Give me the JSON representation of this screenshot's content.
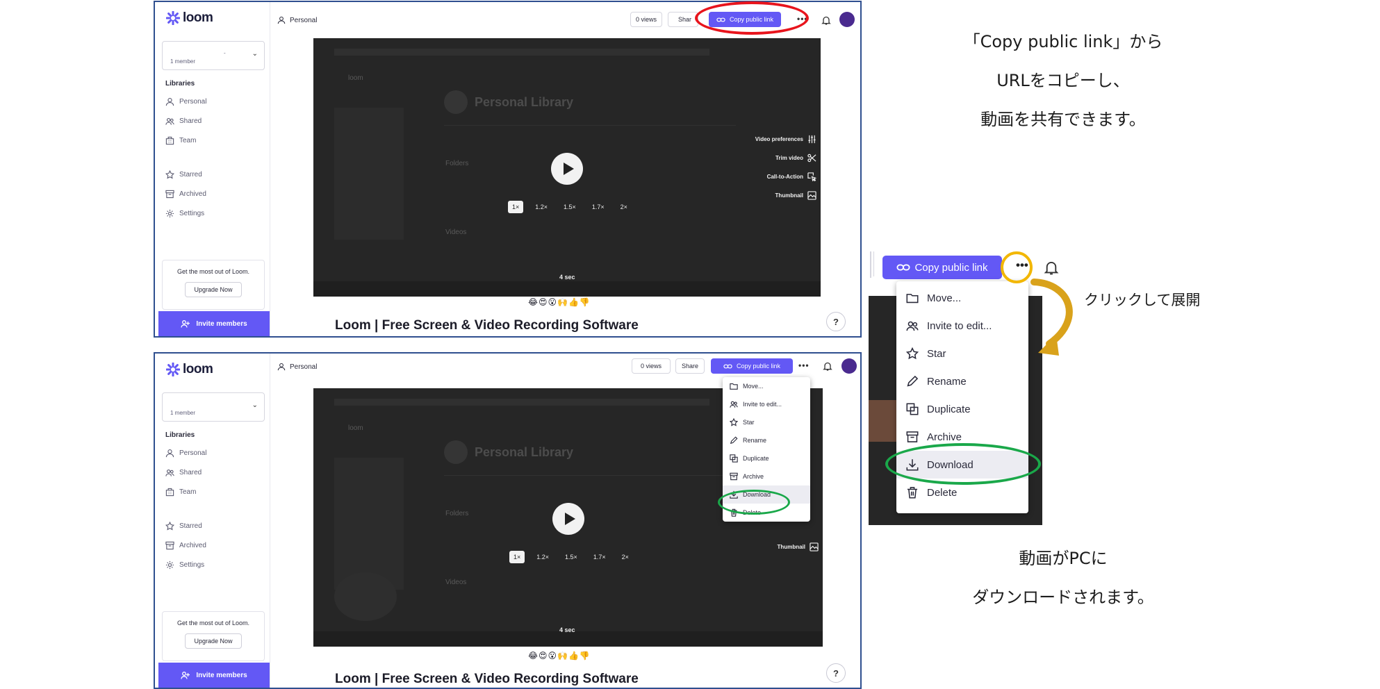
{
  "app": {
    "logo": "loom",
    "workspace_sub": "1 member",
    "workspace_name": "-",
    "libraries_heading": "Libraries",
    "sidebar_items": [
      {
        "label": "Personal",
        "icon": "person-icon"
      },
      {
        "label": "Shared",
        "icon": "people-icon"
      },
      {
        "label": "Team",
        "icon": "building-icon"
      },
      {
        "label": "Starred",
        "icon": "star-icon"
      },
      {
        "label": "Archived",
        "icon": "archive-icon"
      },
      {
        "label": "Settings",
        "icon": "gear-icon"
      }
    ],
    "promo_text": "Get the most out of Loom.",
    "upgrade_label": "Upgrade Now",
    "invite_label": "Invite members",
    "breadcrumb": "Personal",
    "views_label": "0 views",
    "share_label": "Share",
    "share_label_cut": "Shar",
    "copy_link_label": "Copy public link",
    "more_label": "•••",
    "play_label": "play",
    "speeds": [
      "1×",
      "1.2×",
      "1.5×",
      "1.7×",
      "2×"
    ],
    "video_options": [
      "Video preferences",
      "Trim video",
      "Call-to-Action",
      "Thumbnail"
    ],
    "duration": "4 sec",
    "reactions": "😂😍😮🙌👍👎",
    "video_title": "Loom | Free Screen & Video Recording Software",
    "help_label": "?",
    "ghost_library": "Personal Library",
    "ghost_folders": "Folders",
    "ghost_videos": "Videos",
    "ghost_logo": "loom"
  },
  "menu": {
    "items": [
      {
        "label": "Move...",
        "icon": "folder-icon"
      },
      {
        "label": "Invite to edit...",
        "icon": "invite-icon"
      },
      {
        "label": "Star",
        "icon": "star-icon"
      },
      {
        "label": "Rename",
        "icon": "pencil-icon"
      },
      {
        "label": "Duplicate",
        "icon": "duplicate-icon"
      },
      {
        "label": "Archive",
        "icon": "archive-icon"
      },
      {
        "label": "Download",
        "icon": "download-icon"
      },
      {
        "label": "Delete",
        "icon": "trash-icon"
      }
    ],
    "highlighted": "Download"
  },
  "zoom": {
    "copy_link_label": "Copy public link",
    "more_label": "•••"
  },
  "annotations": {
    "copy_link": [
      "「Copy public link」から",
      "URLをコピーし、",
      "動画を共有できます。"
    ],
    "expand": "クリックして展開",
    "download": [
      "動画がPCに",
      "ダウンロードされます。"
    ]
  },
  "colors": {
    "accent": "#6358f5",
    "red_marker": "#e8141c",
    "green_marker": "#1aa84a",
    "yellow_marker": "#f2b705",
    "arrow_gold": "#d9a21b"
  }
}
